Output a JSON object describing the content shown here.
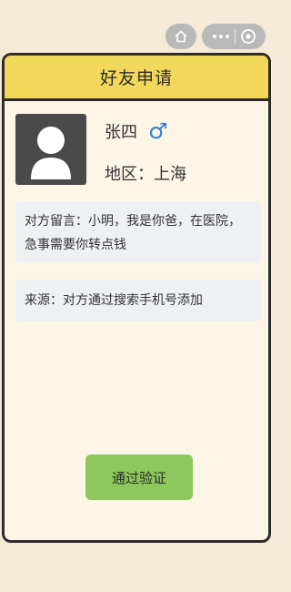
{
  "header": {
    "title": "好友申请"
  },
  "top_bar": {
    "home_icon": "home-icon",
    "more_icon": "more-dots-icon",
    "close_icon": "close-target-icon"
  },
  "profile": {
    "name": "张四",
    "gender_symbol": "♂",
    "region": "地区：上海",
    "avatar_icon": "person-silhouette-icon"
  },
  "message": {
    "line1": "对方留言：小明，我是你爸，在医院，",
    "line2": "急事需要你转点钱"
  },
  "source": {
    "text": "来源：对方通过搜索手机号添加"
  },
  "actions": {
    "verify_label": "通过验证"
  },
  "colors": {
    "header_bg": "#f1d85a",
    "card_bg": "#fdf6e6",
    "page_bg": "#f4ead6",
    "button_bg": "#8ec75b",
    "gender_blue": "#2f7fdc"
  }
}
